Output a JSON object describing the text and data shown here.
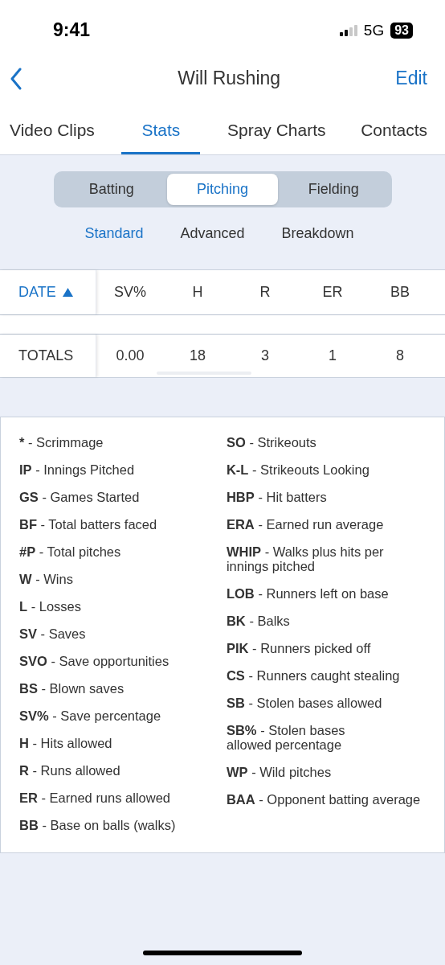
{
  "status_bar": {
    "time": "9:41",
    "network": "5G",
    "battery": "93"
  },
  "nav": {
    "title": "Will Rushing",
    "action": "Edit"
  },
  "tabs": [
    {
      "label": "Video Clips",
      "selected": false
    },
    {
      "label": "Stats",
      "selected": true
    },
    {
      "label": "Spray Charts",
      "selected": false
    },
    {
      "label": "Contacts",
      "selected": false
    }
  ],
  "segments": [
    {
      "label": "Batting",
      "selected": false
    },
    {
      "label": "Pitching",
      "selected": true
    },
    {
      "label": "Fielding",
      "selected": false
    }
  ],
  "sub_tabs": [
    {
      "label": "Standard",
      "selected": true
    },
    {
      "label": "Advanced",
      "selected": false
    },
    {
      "label": "Breakdown",
      "selected": false
    }
  ],
  "table": {
    "columns": [
      {
        "label": "DATE",
        "sorted": true
      },
      {
        "label": "SV%",
        "sorted": false
      },
      {
        "label": "H",
        "sorted": false
      },
      {
        "label": "R",
        "sorted": false
      },
      {
        "label": "ER",
        "sorted": false
      },
      {
        "label": "BB",
        "sorted": false
      }
    ],
    "totals": [
      "TOTALS",
      "0.00",
      "18",
      "3",
      "1",
      "8"
    ]
  },
  "legend": {
    "left": [
      {
        "term": "*",
        "definition": "- Scrimmage"
      },
      {
        "term": "IP",
        "definition": "- Innings Pitched"
      },
      {
        "term": "GS",
        "definition": "- Games Started"
      },
      {
        "term": "BF",
        "definition": "- Total batters faced"
      },
      {
        "term": "#P",
        "definition": "- Total pitches"
      },
      {
        "term": "W",
        "definition": "- Wins"
      },
      {
        "term": "L",
        "definition": "- Losses"
      },
      {
        "term": "SV",
        "definition": "- Saves"
      },
      {
        "term": "SVO",
        "definition": "- Save opportunities"
      },
      {
        "term": "BS",
        "definition": "- Blown saves"
      },
      {
        "term": "SV%",
        "definition": "- Save percentage"
      },
      {
        "term": "H",
        "definition": "- Hits allowed"
      },
      {
        "term": "R",
        "definition": "- Runs allowed"
      },
      {
        "term": "ER",
        "definition": "- Earned runs allowed"
      },
      {
        "term": "BB",
        "definition": "- Base on balls (walks)"
      }
    ],
    "right": [
      {
        "term": "SO",
        "definition": "- Strikeouts"
      },
      {
        "term": "K-L",
        "definition": "- Strikeouts Looking"
      },
      {
        "term": "HBP",
        "definition": "- Hit batters"
      },
      {
        "term": "ERA",
        "definition": "- Earned run average"
      },
      {
        "term": "WHIP",
        "definition": "- Walks plus hits per innings pitched"
      },
      {
        "term": "LOB",
        "definition": "- Runners left on base"
      },
      {
        "term": "BK",
        "definition": "- Balks"
      },
      {
        "term": "PIK",
        "definition": "- Runners picked off"
      },
      {
        "term": "CS",
        "definition": "- Runners caught stealing"
      },
      {
        "term": "SB",
        "definition": "- Stolen bases allowed"
      },
      {
        "term": "SB%",
        "definition": "- Stolen bases\nallowed percentage"
      },
      {
        "term": "WP",
        "definition": "- Wild pitches"
      },
      {
        "term": "BAA",
        "definition": "- Opponent batting average"
      }
    ]
  }
}
